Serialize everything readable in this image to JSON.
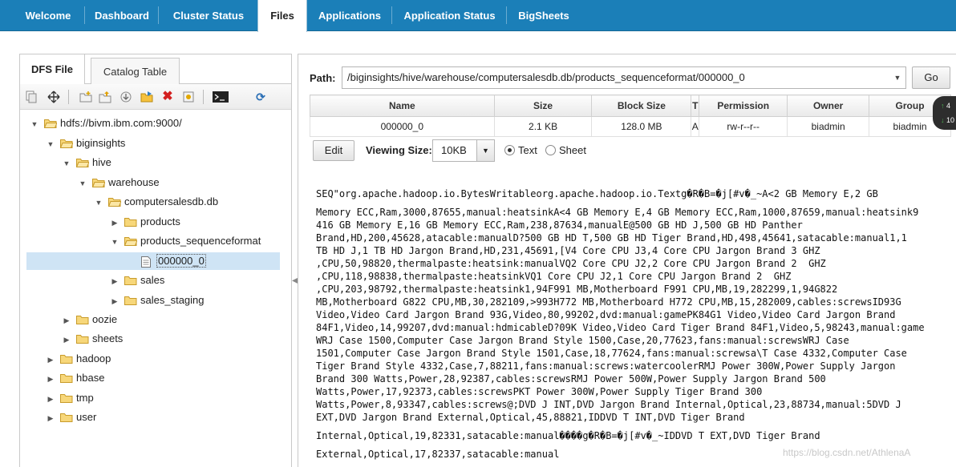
{
  "nav": {
    "tabs": [
      "Welcome",
      "Dashboard",
      "Cluster Status",
      "Files",
      "Applications",
      "Application Status",
      "BigSheets"
    ],
    "active": "Files"
  },
  "left": {
    "tabs": [
      "DFS File",
      "Catalog Table"
    ],
    "active_tab": "DFS File",
    "toolbar_icons": [
      "copy-icon",
      "move-icon",
      "new-folder-icon",
      "upload-icon",
      "download-icon",
      "open-folder-icon",
      "delete-icon",
      "properties-icon",
      "terminal-icon",
      "refresh-icon"
    ],
    "tree": [
      {
        "label": "hdfs://bivm.ibm.com:9000/",
        "expanded": true
      },
      {
        "label": "biginsights",
        "expanded": true
      },
      {
        "label": "hive",
        "expanded": true
      },
      {
        "label": "warehouse",
        "expanded": true
      },
      {
        "label": "computersalesdb.db",
        "expanded": true
      },
      {
        "label": "products",
        "expanded": false
      },
      {
        "label": "products_sequenceformat",
        "expanded": true
      },
      {
        "label": "000000_0",
        "selected": true
      },
      {
        "label": "sales",
        "expanded": false
      },
      {
        "label": "sales_staging",
        "expanded": false
      },
      {
        "label": "oozie",
        "expanded": false
      },
      {
        "label": "sheets",
        "expanded": false
      },
      {
        "label": "hadoop",
        "expanded": false
      },
      {
        "label": "hbase",
        "expanded": false
      },
      {
        "label": "tmp",
        "expanded": false
      },
      {
        "label": "user",
        "expanded": false
      }
    ]
  },
  "right": {
    "path_label": "Path:",
    "path_value": "/biginsights/hive/warehouse/computersalesdb.db/products_sequenceformat/000000_0",
    "go_label": "Go",
    "columns": [
      "Name",
      "Size",
      "Block Size",
      "T",
      "Permission",
      "Owner",
      "Group"
    ],
    "row": [
      "000000_0",
      "2.1 KB",
      "128.0 MB",
      "A",
      "rw-r--r--",
      "biadmin",
      "biadmin"
    ],
    "edit_label": "Edit",
    "viewing_size_label": "Viewing Size:",
    "viewing_size_value": "10KB",
    "view_modes": [
      "Text",
      "Sheet"
    ],
    "view_mode_selected": "Text",
    "content_lines": [
      "SEQ\"org.apache.hadoop.io.BytesWritableorg.apache.hadoop.io.Textg�R�B=�j[#v�_~A<2 GB Memory E,2 GB",
      "",
      "Memory ECC,Ram,3000,87655,manual:heatsinkA<4 GB Memory E,4 GB Memory ECC,Ram,1000,87659,manual:heatsink9",
      "416 GB Memory E,16 GB Memory ECC,Ram,238,87634,manualE@500 GB HD J,500 GB HD Panther",
      "Brand,HD,200,45628,atacable:manualD?500 GB HD T,500 GB HD Tiger Brand,HD,498,45641,satacable:manual1,1",
      "TB HD J,1 TB HD Jargon Brand,HD,231,45691,[V4 Core CPU J3,4 Core CPU Jargon Brand 3 GHZ",
      ",CPU,50,98820,thermalpaste:heatsink:manualVQ2 Core CPU J2,2 Core CPU Jargon Brand 2  GHZ",
      ",CPU,118,98838,thermalpaste:heatsinkVQ1 Core CPU J2,1 Core CPU Jargon Brand 2  GHZ",
      ",CPU,203,98792,thermalpaste:heatsink1,94F991 MB,Motherboard F991 CPU,MB,19,282299,1,94G822",
      "MB,Motherboard G822 CPU,MB,30,282109,>993H772 MB,Motherboard H772 CPU,MB,15,282009,cables:screwsID93G",
      "Video,Video Card Jargon Brand 93G,Video,80,99202,dvd:manual:gamePK84G1 Video,Video Card Jargon Brand",
      "84F1,Video,14,99207,dvd:manual:hdmicableD?09K Video,Video Card Tiger Brand 84F1,Video,5,98243,manual:game",
      "WRJ Case 1500,Computer Case Jargon Brand Style 1500,Case,20,77623,fans:manual:screwsWRJ Case",
      "1501,Computer Case Jargon Brand Style 1501,Case,18,77624,fans:manual:screwsa\\T Case 4332,Computer Case",
      "Tiger Brand Style 4332,Case,7,88211,fans:manual:screws:watercoolerRMJ Power 300W,Power Supply Jargon",
      "Brand 300 Watts,Power,28,92387,cables:screwsRMJ Power 500W,Power Supply Jargon Brand 500",
      "Watts,Power,17,92373,cables:screwsPKT Power 300W,Power Supply Tiger Brand 300",
      "Watts,Power,8,93347,cables:screws@;DVD J INT,DVD Jargon Brand Internal,Optical,23,88734,manual:5DVD J",
      "EXT,DVD Jargon Brand External,Optical,45,88821,IDDVD T INT,DVD Tiger Brand",
      "",
      "Internal,Optical,19,82331,satacable:manual����g�R�B=�j[#v�_~IDDVD T EXT,DVD Tiger Brand",
      "",
      "External,Optical,17,82337,satacable:manual"
    ]
  },
  "side_widget": {
    "up": "4",
    "down": "10"
  },
  "watermark": "https://blog.csdn.net/AthlenaA"
}
